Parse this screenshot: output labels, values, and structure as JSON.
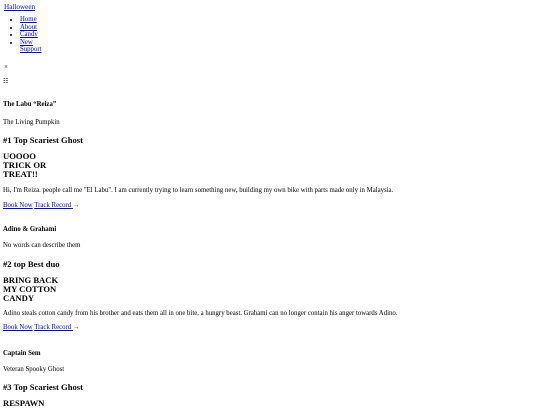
{
  "brand": "Halloween",
  "nav": [
    "Home",
    "About",
    "Candy",
    "New",
    "Support"
  ],
  "close_glyph": "×",
  "menu_glyph": "☷",
  "cards": [
    {
      "name": "The Labu “Reiza”",
      "subtitle": "The Living Pumpkin",
      "rank": "#1 Top Scariest Ghost",
      "headline": [
        "UOOOO",
        "TRICK OR",
        "TREAT!!"
      ],
      "description": "Hi, I'm Reiza. people call me \"El Labu\". I am currently trying to learn something new, building my own bike with parts made only in Malaysia.",
      "book_label": "Book Now",
      "track_label": "Track Record",
      "arrow": "→"
    },
    {
      "name": "Adino & Grahami",
      "subtitle": "No words can describe them",
      "rank": "#2 top Best duo",
      "headline": [
        "BRING BACK",
        "MY COTTON",
        "CANDY"
      ],
      "description": "Adino steals cotton candy from his brother and eats them all in one bite, a hungry beast. Grahami can no longer contain his anger towards Adino.",
      "book_label": "Book Now",
      "track_label": "Track Record",
      "arrow": "→"
    },
    {
      "name": "Captain Sem",
      "subtitle": "Veteran Spooky Ghost",
      "rank": "#3 Top Scariest Ghost",
      "headline": [
        "RESPAWN"
      ]
    }
  ]
}
